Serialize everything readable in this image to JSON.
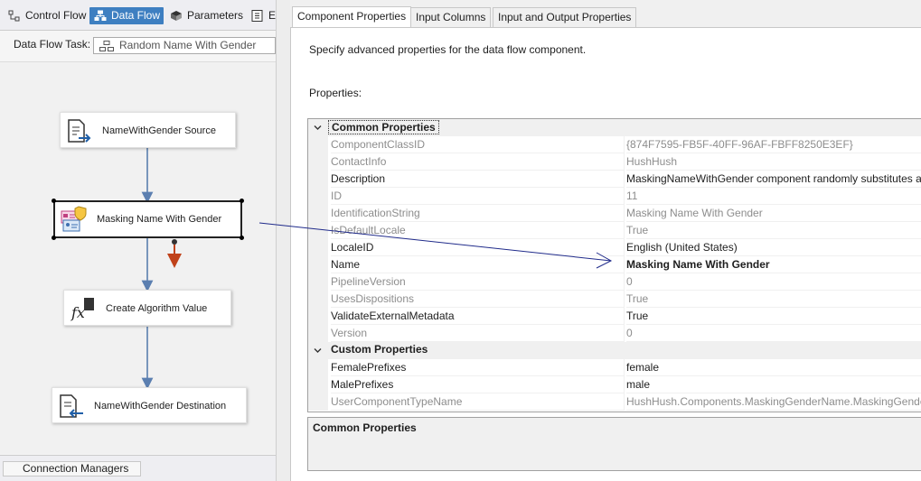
{
  "designer": {
    "tabs": [
      {
        "label": "Control Flow",
        "icon": "control-flow-icon"
      },
      {
        "label": "Data Flow",
        "icon": "data-flow-icon",
        "active": true
      },
      {
        "label": "Parameters",
        "icon": "parameters-icon"
      },
      {
        "label": "E",
        "icon": "event-handlers-icon"
      }
    ],
    "task_label": "Data Flow Task:",
    "task_value": "Random Name With Gender",
    "components": [
      {
        "label": "NameWithGender Source",
        "icon": "source-icon"
      },
      {
        "label": "Masking Name With Gender",
        "icon": "masking-component-icon",
        "selected": true
      },
      {
        "label": "Create Algorithm Value",
        "icon": "derived-column-icon"
      },
      {
        "label": "NameWithGender Destination",
        "icon": "destination-icon"
      }
    ],
    "connection_managers": "Connection Managers"
  },
  "editor": {
    "tabs": [
      {
        "label": "Component Properties",
        "active": true
      },
      {
        "label": "Input Columns"
      },
      {
        "label": "Input and Output Properties"
      }
    ],
    "description": "Specify advanced properties for the data flow component.",
    "properties_label": "Properties:",
    "categories": {
      "common": "Common Properties",
      "custom": "Custom Properties"
    },
    "rows": [
      {
        "name": "ComponentClassID",
        "value": "{874F7595-FB5F-40FF-96AF-FBFF8250E3EF}",
        "dim": true
      },
      {
        "name": "ContactInfo",
        "value": "HushHush",
        "dim": true
      },
      {
        "name": "Description",
        "value": "MaskingNameWithGender component randomly substitutes a",
        "dim": false
      },
      {
        "name": "ID",
        "value": "11",
        "dim": true
      },
      {
        "name": "IdentificationString",
        "value": "Masking Name With Gender",
        "dim": true
      },
      {
        "name": "IsDefaultLocale",
        "value": "True",
        "dim": true
      },
      {
        "name": "LocaleID",
        "value": "English (United States)",
        "dim": false
      },
      {
        "name": "Name",
        "value": "Masking Name With Gender",
        "dim": false,
        "bold": true
      },
      {
        "name": "PipelineVersion",
        "value": "0",
        "dim": true
      },
      {
        "name": "UsesDispositions",
        "value": "True",
        "dim": true
      },
      {
        "name": "ValidateExternalMetadata",
        "value": "True",
        "dim": false
      },
      {
        "name": "Version",
        "value": "0",
        "dim": true
      }
    ],
    "custom_rows": [
      {
        "name": "FemalePrefixes",
        "value": "female",
        "dim": false
      },
      {
        "name": "MalePrefixes",
        "value": "male",
        "dim": false
      },
      {
        "name": "UserComponentTypeName",
        "value": "HushHush.Components.MaskingGenderName.MaskingGende",
        "dim": true
      }
    ],
    "help_title": "Common Properties"
  },
  "colors": {
    "accent": "#3e7fc1",
    "arrow": "#1f2a8a",
    "error_arrow": "#c0421a",
    "connector": "#5b7fb0"
  }
}
